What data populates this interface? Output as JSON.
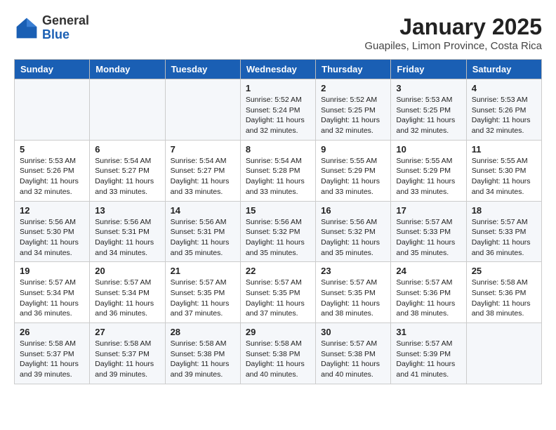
{
  "header": {
    "logo_general": "General",
    "logo_blue": "Blue",
    "month_year": "January 2025",
    "location": "Guapiles, Limon Province, Costa Rica"
  },
  "weekdays": [
    "Sunday",
    "Monday",
    "Tuesday",
    "Wednesday",
    "Thursday",
    "Friday",
    "Saturday"
  ],
  "weeks": [
    [
      {
        "day": "",
        "info": ""
      },
      {
        "day": "",
        "info": ""
      },
      {
        "day": "",
        "info": ""
      },
      {
        "day": "1",
        "info": "Sunrise: 5:52 AM\nSunset: 5:24 PM\nDaylight: 11 hours and 32 minutes."
      },
      {
        "day": "2",
        "info": "Sunrise: 5:52 AM\nSunset: 5:25 PM\nDaylight: 11 hours and 32 minutes."
      },
      {
        "day": "3",
        "info": "Sunrise: 5:53 AM\nSunset: 5:25 PM\nDaylight: 11 hours and 32 minutes."
      },
      {
        "day": "4",
        "info": "Sunrise: 5:53 AM\nSunset: 5:26 PM\nDaylight: 11 hours and 32 minutes."
      }
    ],
    [
      {
        "day": "5",
        "info": "Sunrise: 5:53 AM\nSunset: 5:26 PM\nDaylight: 11 hours and 32 minutes."
      },
      {
        "day": "6",
        "info": "Sunrise: 5:54 AM\nSunset: 5:27 PM\nDaylight: 11 hours and 33 minutes."
      },
      {
        "day": "7",
        "info": "Sunrise: 5:54 AM\nSunset: 5:27 PM\nDaylight: 11 hours and 33 minutes."
      },
      {
        "day": "8",
        "info": "Sunrise: 5:54 AM\nSunset: 5:28 PM\nDaylight: 11 hours and 33 minutes."
      },
      {
        "day": "9",
        "info": "Sunrise: 5:55 AM\nSunset: 5:29 PM\nDaylight: 11 hours and 33 minutes."
      },
      {
        "day": "10",
        "info": "Sunrise: 5:55 AM\nSunset: 5:29 PM\nDaylight: 11 hours and 33 minutes."
      },
      {
        "day": "11",
        "info": "Sunrise: 5:55 AM\nSunset: 5:30 PM\nDaylight: 11 hours and 34 minutes."
      }
    ],
    [
      {
        "day": "12",
        "info": "Sunrise: 5:56 AM\nSunset: 5:30 PM\nDaylight: 11 hours and 34 minutes."
      },
      {
        "day": "13",
        "info": "Sunrise: 5:56 AM\nSunset: 5:31 PM\nDaylight: 11 hours and 34 minutes."
      },
      {
        "day": "14",
        "info": "Sunrise: 5:56 AM\nSunset: 5:31 PM\nDaylight: 11 hours and 35 minutes."
      },
      {
        "day": "15",
        "info": "Sunrise: 5:56 AM\nSunset: 5:32 PM\nDaylight: 11 hours and 35 minutes."
      },
      {
        "day": "16",
        "info": "Sunrise: 5:56 AM\nSunset: 5:32 PM\nDaylight: 11 hours and 35 minutes."
      },
      {
        "day": "17",
        "info": "Sunrise: 5:57 AM\nSunset: 5:33 PM\nDaylight: 11 hours and 35 minutes."
      },
      {
        "day": "18",
        "info": "Sunrise: 5:57 AM\nSunset: 5:33 PM\nDaylight: 11 hours and 36 minutes."
      }
    ],
    [
      {
        "day": "19",
        "info": "Sunrise: 5:57 AM\nSunset: 5:34 PM\nDaylight: 11 hours and 36 minutes."
      },
      {
        "day": "20",
        "info": "Sunrise: 5:57 AM\nSunset: 5:34 PM\nDaylight: 11 hours and 36 minutes."
      },
      {
        "day": "21",
        "info": "Sunrise: 5:57 AM\nSunset: 5:35 PM\nDaylight: 11 hours and 37 minutes."
      },
      {
        "day": "22",
        "info": "Sunrise: 5:57 AM\nSunset: 5:35 PM\nDaylight: 11 hours and 37 minutes."
      },
      {
        "day": "23",
        "info": "Sunrise: 5:57 AM\nSunset: 5:35 PM\nDaylight: 11 hours and 38 minutes."
      },
      {
        "day": "24",
        "info": "Sunrise: 5:57 AM\nSunset: 5:36 PM\nDaylight: 11 hours and 38 minutes."
      },
      {
        "day": "25",
        "info": "Sunrise: 5:58 AM\nSunset: 5:36 PM\nDaylight: 11 hours and 38 minutes."
      }
    ],
    [
      {
        "day": "26",
        "info": "Sunrise: 5:58 AM\nSunset: 5:37 PM\nDaylight: 11 hours and 39 minutes."
      },
      {
        "day": "27",
        "info": "Sunrise: 5:58 AM\nSunset: 5:37 PM\nDaylight: 11 hours and 39 minutes."
      },
      {
        "day": "28",
        "info": "Sunrise: 5:58 AM\nSunset: 5:38 PM\nDaylight: 11 hours and 39 minutes."
      },
      {
        "day": "29",
        "info": "Sunrise: 5:58 AM\nSunset: 5:38 PM\nDaylight: 11 hours and 40 minutes."
      },
      {
        "day": "30",
        "info": "Sunrise: 5:57 AM\nSunset: 5:38 PM\nDaylight: 11 hours and 40 minutes."
      },
      {
        "day": "31",
        "info": "Sunrise: 5:57 AM\nSunset: 5:39 PM\nDaylight: 11 hours and 41 minutes."
      },
      {
        "day": "",
        "info": ""
      }
    ]
  ]
}
